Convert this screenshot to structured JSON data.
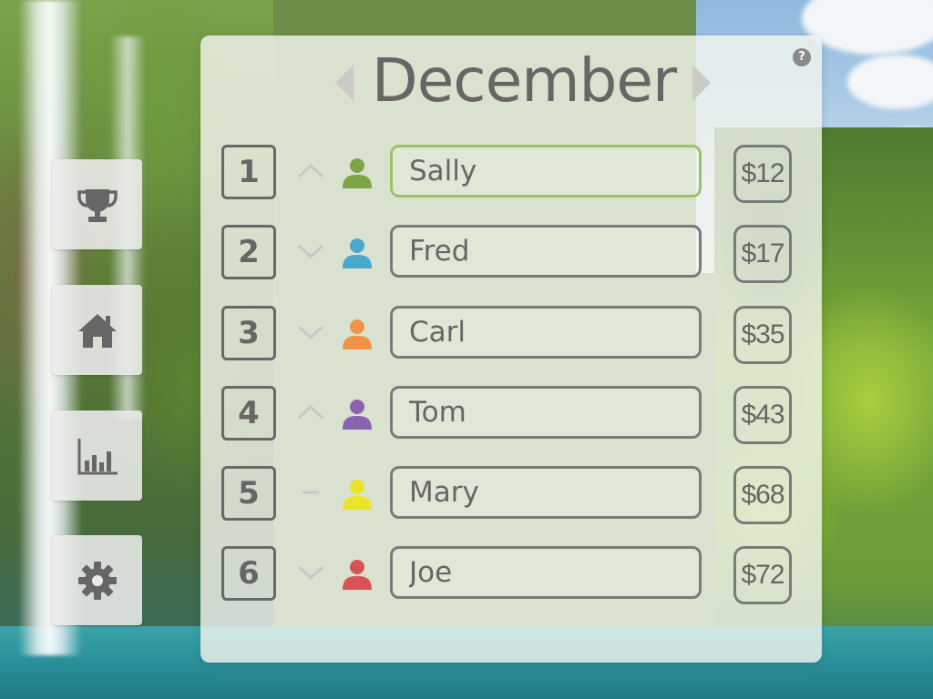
{
  "header": {
    "month": "December",
    "help_symbol": "?",
    "prev_icon": "chevron-left-icon",
    "next_icon": "chevron-right-icon"
  },
  "sidebar": {
    "items": [
      {
        "name": "leaderboard",
        "icon": "trophy-icon"
      },
      {
        "name": "home",
        "icon": "home-icon"
      },
      {
        "name": "stats",
        "icon": "bar-chart-icon"
      },
      {
        "name": "settings",
        "icon": "gear-icon"
      }
    ]
  },
  "colors": {
    "text": "#666666",
    "border": "#7a7a7a",
    "active_border": "#9cc166",
    "trend_arrow": "#c8c8c8"
  },
  "rows": [
    {
      "rank": "1",
      "trend": "up",
      "avatar_color": "#7ca645",
      "name": "Sally",
      "amount": "$12",
      "active": true
    },
    {
      "rank": "2",
      "trend": "down",
      "avatar_color": "#4aa8cc",
      "name": "Fred",
      "amount": "$17",
      "active": false
    },
    {
      "rank": "3",
      "trend": "down",
      "avatar_color": "#f19345",
      "name": "Carl",
      "amount": "$35",
      "active": false
    },
    {
      "rank": "4",
      "trend": "up",
      "avatar_color": "#8a62b0",
      "name": "Tom",
      "amount": "$43",
      "active": false
    },
    {
      "rank": "5",
      "trend": "same",
      "avatar_color": "#e9e42a",
      "name": "Mary",
      "amount": "$68",
      "active": false
    },
    {
      "rank": "6",
      "trend": "down",
      "avatar_color": "#d65454",
      "name": "Joe",
      "amount": "$72",
      "active": false
    }
  ]
}
